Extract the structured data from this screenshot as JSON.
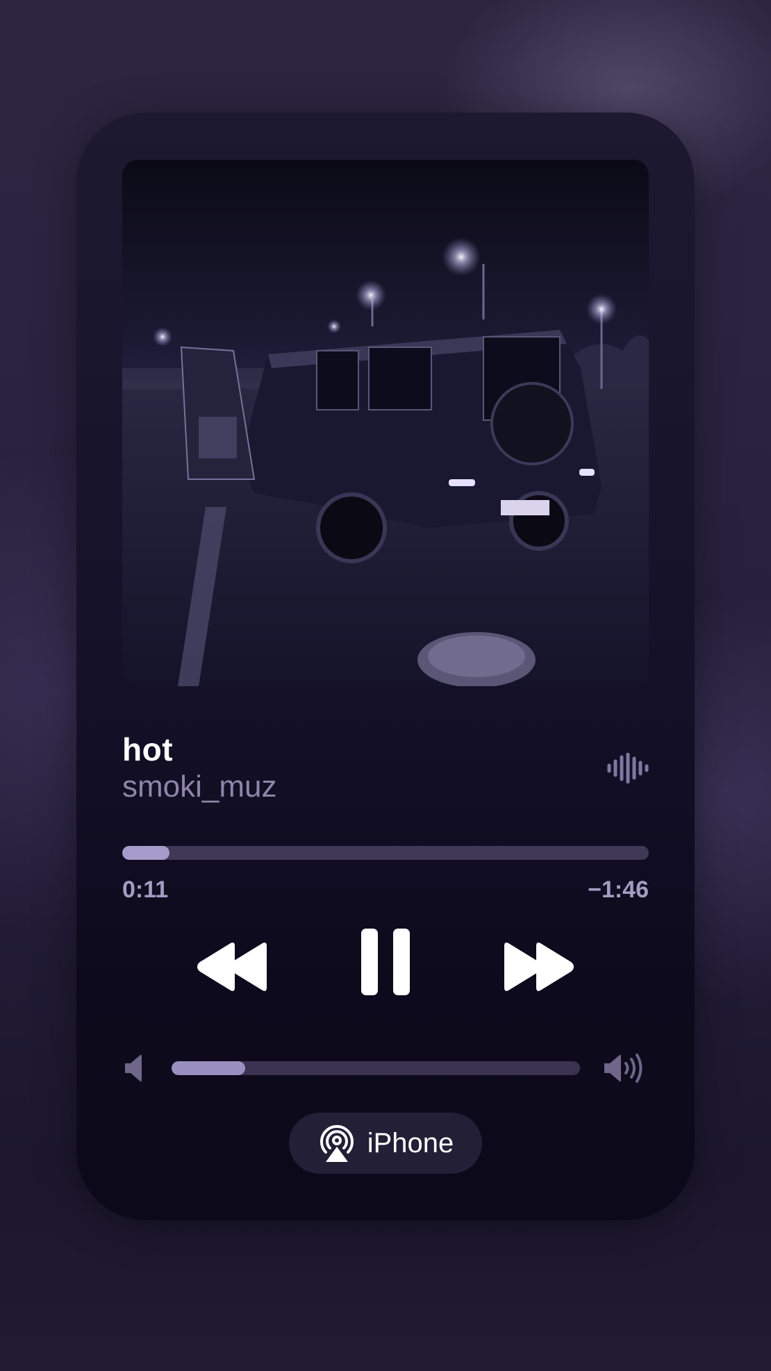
{
  "track": {
    "title": "hot",
    "artist": "smoki_muz"
  },
  "playback": {
    "elapsed": "0:11",
    "remaining": "−1:46",
    "progress_fraction": 0.09,
    "state": "playing"
  },
  "volume": {
    "level_fraction": 0.18
  },
  "output": {
    "device_label": "iPhone"
  },
  "icons": {
    "waveform": "waveform-icon",
    "rewind": "backward-icon",
    "pause": "pause-icon",
    "forward": "forward-icon",
    "volume_low": "speaker-low-icon",
    "volume_high": "speaker-high-icon",
    "airplay": "airplay-icon"
  },
  "colors": {
    "accent": "#a59ccc",
    "artist_text": "#8d86a8",
    "time_text": "#a49dc2"
  }
}
